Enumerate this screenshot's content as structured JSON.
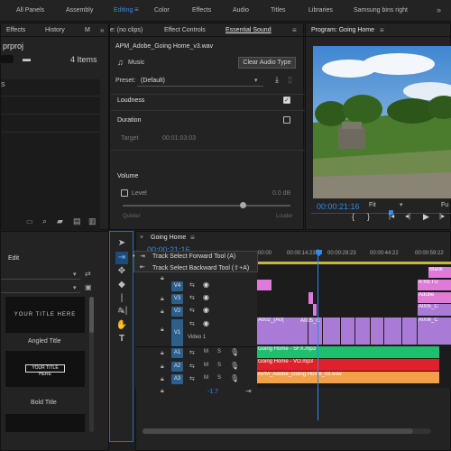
{
  "workspaces": [
    {
      "label": "All Panels",
      "active": false
    },
    {
      "label": "Assembly",
      "active": false
    },
    {
      "label": "Editing",
      "active": true
    },
    {
      "label": "Color",
      "active": false
    },
    {
      "label": "Effects",
      "active": false
    },
    {
      "label": "Audio",
      "active": false
    },
    {
      "label": "Titles",
      "active": false
    },
    {
      "label": "Libraries",
      "active": false
    },
    {
      "label": "Samsung bins right",
      "active": false
    }
  ],
  "project_panel": {
    "tabs": [
      "Effects",
      "History",
      "M"
    ],
    "project_name": "prproj",
    "item_count": "4 Items",
    "row_label": "S"
  },
  "source_panel": {
    "tabs": {
      "source": "e: (no clips)",
      "effect_controls": "Effect Controls",
      "essential_sound": "Essential Sound"
    },
    "file_name": "APM_Adobe_Going Home_v3.wav",
    "music_label": "Music",
    "clear_button": "Clear Audio Type",
    "preset_label": "Preset:",
    "preset_value": "(Default)",
    "loudness_label": "Loudness",
    "loudness_checked": true,
    "duration_label": "Duration",
    "duration_checked": false,
    "target_label": "Target",
    "target_value": "00:01:03:03",
    "volume_label": "Volume",
    "level_label": "Level",
    "level_value": "0.0 dB",
    "quieter_label": "Quieter",
    "louder_label": "Louder"
  },
  "program_panel": {
    "title": "Program: Going Home",
    "timecode": "00:00:21:16",
    "fit_label": "Fit",
    "right_label": "Fu"
  },
  "library_panel": {
    "edit_label": "Edit",
    "titles": [
      {
        "thumb_text": "YOUR TITLE HERE",
        "label": "Angled Title"
      },
      {
        "thumb_text": "YOUR TITLE HERE",
        "label": "Bold Title"
      }
    ]
  },
  "tools_flyout": {
    "items": [
      {
        "label": "Track Select Forward Tool (A)"
      },
      {
        "label": "Track Select Backward Tool (⇧+A)"
      }
    ]
  },
  "timeline": {
    "tab": "Going Home",
    "timecode": "00:00:21:16",
    "ruler": [
      "00:00",
      "00:00:14:23",
      "00:00:29:23",
      "00:00:44:22",
      "00:00:59:22"
    ],
    "video_tracks": [
      "V4",
      "V3",
      "V2",
      "V1"
    ],
    "video1_name": "Video 1",
    "audio_tracks": [
      "A1",
      "A2",
      "A3"
    ],
    "audio_clips": [
      {
        "label": "Going Home - SFX.mp3",
        "color": "#1fbf6e"
      },
      {
        "label": "Going Home - VO.mp3",
        "color": "#e0202a"
      },
      {
        "label": "APM_Adobe_Going Home_v3.wav",
        "color": "#f0a14a"
      }
    ],
    "video_clips": [
      "A002_(A0(",
      "A005_C",
      "Blank",
      "A RETU",
      "Adobe",
      "A005_C",
      "A006_C"
    ],
    "volume_value": "-1.7"
  },
  "colors": {
    "accent": "#2d8ceb",
    "playhead": "#2d8ceb",
    "clip_video": "#a97bd6",
    "clip_pink": "#e07ad8"
  }
}
